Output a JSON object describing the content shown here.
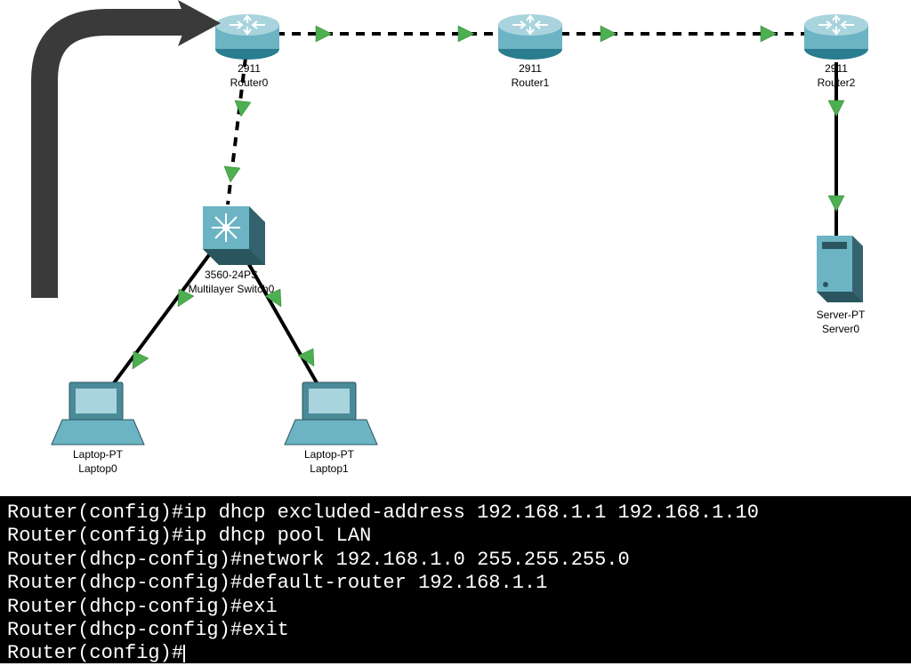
{
  "devices": {
    "router0": {
      "model": "2911",
      "name": "Router0",
      "type": "router"
    },
    "router1": {
      "model": "2911",
      "name": "Router1",
      "type": "router"
    },
    "router2": {
      "model": "2911",
      "name": "Router2",
      "type": "router"
    },
    "switch0": {
      "model": "3560-24PS",
      "name": "Multilayer Switch0",
      "type": "multilayer-switch"
    },
    "laptop0": {
      "model": "Laptop-PT",
      "name": "Laptop0",
      "type": "laptop"
    },
    "laptop1": {
      "model": "Laptop-PT",
      "name": "Laptop1",
      "type": "laptop"
    },
    "server0": {
      "model": "Server-PT",
      "name": "Server0",
      "type": "server"
    }
  },
  "links": [
    {
      "from": "router0",
      "to": "router1",
      "style": "dashed",
      "status": "up"
    },
    {
      "from": "router1",
      "to": "router2",
      "style": "dashed",
      "status": "up"
    },
    {
      "from": "router0",
      "to": "switch0",
      "style": "dashed",
      "status": "up"
    },
    {
      "from": "router2",
      "to": "server0",
      "style": "solid",
      "status": "up"
    },
    {
      "from": "switch0",
      "to": "laptop0",
      "style": "solid",
      "status": "up"
    },
    {
      "from": "switch0",
      "to": "laptop1",
      "style": "solid",
      "status": "up"
    }
  ],
  "annotation_arrow": {
    "target": "router0"
  },
  "terminal": {
    "lines": [
      "Router(config)#ip dhcp excluded-address 192.168.1.1 192.168.1.10",
      "Router(config)#ip dhcp pool LAN",
      "Router(dhcp-config)#network 192.168.1.0 255.255.255.0",
      "Router(dhcp-config)#default-router 192.168.1.1",
      "Router(dhcp-config)#exi",
      "Router(dhcp-config)#exit",
      "Router(config)#"
    ]
  }
}
